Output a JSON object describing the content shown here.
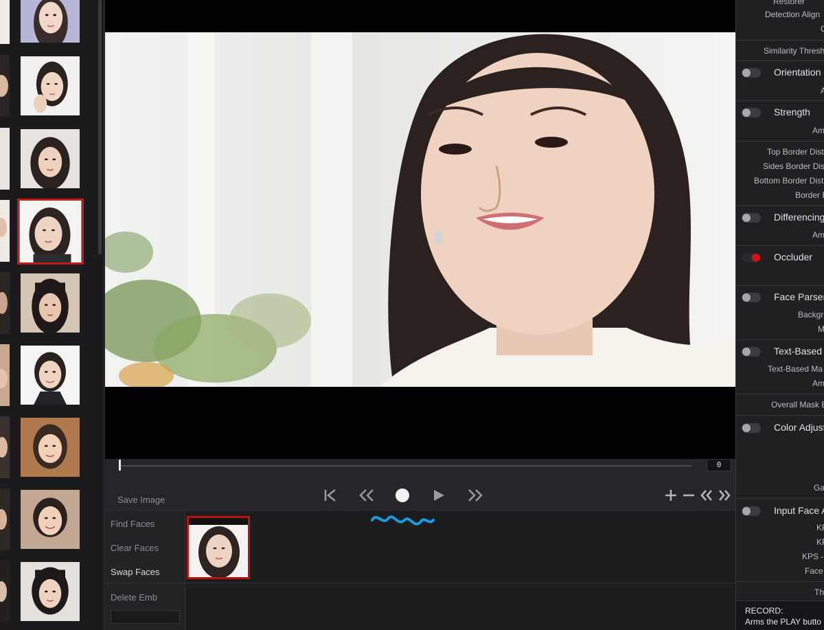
{
  "left_strip": {
    "thumbnails": [
      {
        "name": "face-thumb-1",
        "selected": false
      },
      {
        "name": "face-thumb-2",
        "selected": false
      },
      {
        "name": "face-thumb-3",
        "selected": false
      },
      {
        "name": "face-thumb-4",
        "selected": true
      },
      {
        "name": "face-thumb-5",
        "selected": false
      },
      {
        "name": "face-thumb-6",
        "selected": false
      },
      {
        "name": "face-thumb-7",
        "selected": false
      },
      {
        "name": "face-thumb-8",
        "selected": false
      },
      {
        "name": "face-thumb-9",
        "selected": false
      }
    ]
  },
  "timeline": {
    "frame": "0",
    "position_fraction": 0
  },
  "controls": {
    "save_image": "Save Image",
    "icons": [
      "skip-to-start-icon",
      "rewind-icon",
      "record-icon",
      "play-icon",
      "fast-forward-icon",
      "add-marker-icon",
      "remove-marker-icon",
      "previous-marker-icon",
      "next-marker-icon"
    ]
  },
  "faces": {
    "find": "Find Faces",
    "clear": "Clear Faces",
    "swap": "Swap Faces",
    "delete": "Delete Emb"
  },
  "right_panel": {
    "restorer": "Restorer",
    "detection_align": "Detection Align",
    "similarity": "Similarity Thresh",
    "orientation": "Orientation",
    "strength": "Strength",
    "top_border": "Top Border Dist",
    "sides_border": "Sides Border Dist",
    "bottom_border": "Bottom Border Dist",
    "border_blur": "Border B",
    "differencing": "Differencing",
    "occluder": "Occluder",
    "face_parser": "Face Parser",
    "background": "Backgr",
    "text_based": "Text-Based M",
    "text_based_mask": "Text-Based Ma",
    "overall_mask": "Overall Mask B",
    "color_adjust": "Color Adjust",
    "gamma": "Ga",
    "input_face": "Input Face A",
    "kps1": "KP",
    "kps2": "KP",
    "kps3": "KPS -",
    "face": "Face",
    "th": "Th",
    "a1": "A",
    "am1": "Am",
    "am2": "Am",
    "am3": "Am",
    "m1": "M",
    "c1": "C",
    "record_title": "RECORD:",
    "record_text": "Arms the PLAY butto"
  },
  "colors": {
    "accent_red": "#c21b1b",
    "squiggle_blue": "#1a9be0"
  }
}
